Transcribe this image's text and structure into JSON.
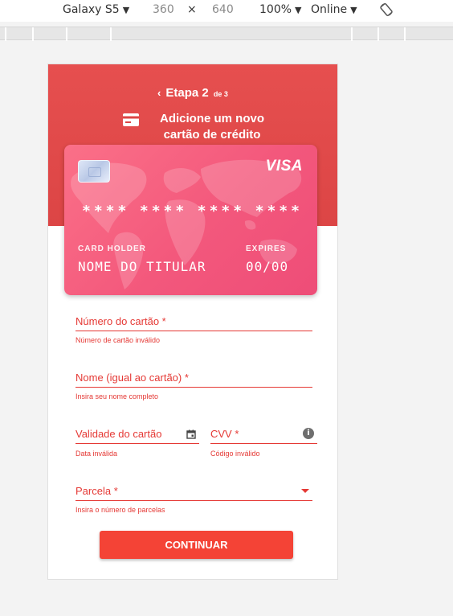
{
  "devtools": {
    "device": "Galaxy S5",
    "width": "360",
    "times": "×",
    "height": "640",
    "zoom": "100%",
    "network": "Online",
    "caret": "▼"
  },
  "header": {
    "step_label": "Etapa 2",
    "step_sub": "de 3",
    "back_glyph": "‹",
    "title_line1": "Adicione um novo",
    "title_line2": "cartão de crédito"
  },
  "card": {
    "brand": "VISA",
    "number_groups": [
      "****",
      "****",
      "****",
      "****"
    ],
    "holder_label": "CARD HOLDER",
    "holder_value": "NOME DO TITULAR",
    "expires_label": "EXPIRES",
    "expires_value": "00/00"
  },
  "form": {
    "card_number": {
      "placeholder": "Número do cartão *",
      "error": "Número de cartão inválido"
    },
    "name": {
      "placeholder": "Nome (igual ao cartão) *",
      "error": "Insira seu nome completo"
    },
    "expiry": {
      "placeholder": "Validade do cartão",
      "error": "Data inválida"
    },
    "cvv": {
      "placeholder": "CVV *",
      "error": "Código inválido",
      "info_glyph": "i"
    },
    "installments": {
      "placeholder": "Parcela *",
      "error": "Insira o número de parcelas"
    }
  },
  "button": {
    "label": "CONTINUAR"
  },
  "colors": {
    "header": "#dc4545",
    "accent": "#e53935",
    "button": "#f44336",
    "card": "#f3587c"
  }
}
